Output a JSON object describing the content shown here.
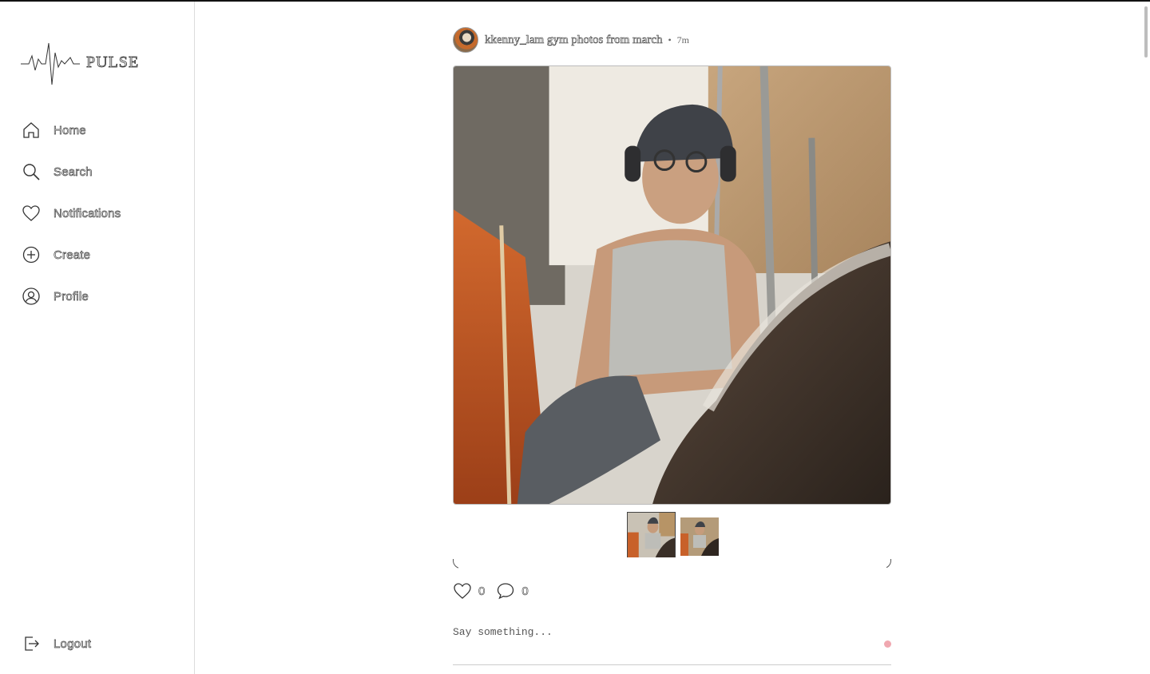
{
  "app": {
    "name": "PULSE"
  },
  "sidebar": {
    "items": [
      {
        "label": "Home",
        "icon": "home-icon"
      },
      {
        "label": "Search",
        "icon": "search-icon"
      },
      {
        "label": "Notifications",
        "icon": "heart-icon"
      },
      {
        "label": "Create",
        "icon": "plus-circle-icon"
      },
      {
        "label": "Profile",
        "icon": "profile-icon"
      }
    ],
    "logout": {
      "label": "Logout",
      "icon": "logout-icon"
    }
  },
  "post": {
    "username": "kkenny_l",
    "caption": "am gym photos from march",
    "separator": "•",
    "time": "7m",
    "image_count": 2,
    "active_image": 1,
    "likes": "0",
    "comments": "0"
  },
  "comment_box": {
    "placeholder": "Say something..."
  },
  "colors": {
    "accent": "#f0a8b0",
    "border": "#dcdcdc"
  }
}
